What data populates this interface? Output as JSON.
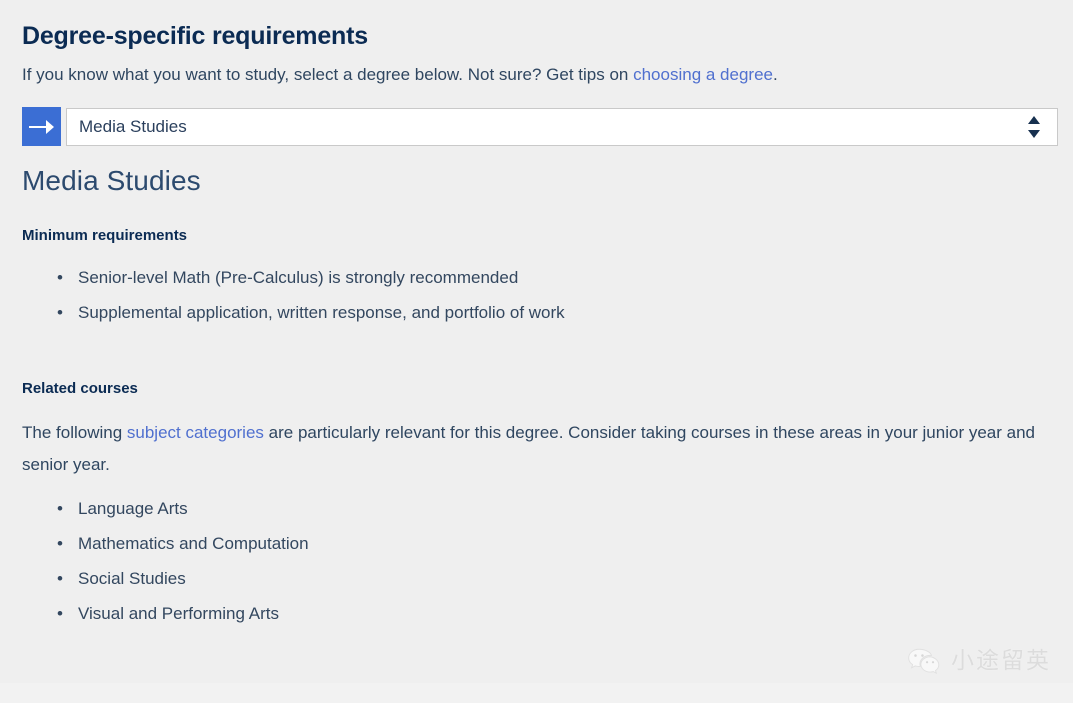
{
  "page": {
    "background_color": "#efefef",
    "text_color": "#233a5e",
    "link_color": "#5070cf",
    "accent_color": "#3b6ed4"
  },
  "header": {
    "title": "Degree-specific requirements",
    "intro_before_link": "If you know what you want to study, select a degree below. Not sure? Get tips on ",
    "intro_link": "choosing a degree",
    "intro_after_link": "."
  },
  "degree_select": {
    "icon": "arrow-right-icon",
    "selected_value": "Media Studies",
    "indicator_icon": "up-down-spinner-icon"
  },
  "degree": {
    "name": "Media Studies",
    "minimum_requirements": {
      "heading": "Minimum requirements",
      "items": [
        "Senior-level Math (Pre-Calculus) is strongly recommended",
        "Supplemental application, written response, and portfolio of work"
      ]
    },
    "related_courses": {
      "heading": "Related courses",
      "para_before_link": "The following ",
      "para_link": "subject categories",
      "para_after_link": " are particularly relevant for this degree. Consider taking courses in these areas in your junior year and senior year.",
      "items": [
        "Language Arts",
        "Mathematics and Computation",
        "Social Studies",
        "Visual and Performing Arts"
      ]
    }
  },
  "watermark": {
    "icon": "wechat-logo-icon",
    "text": "小途留英"
  }
}
